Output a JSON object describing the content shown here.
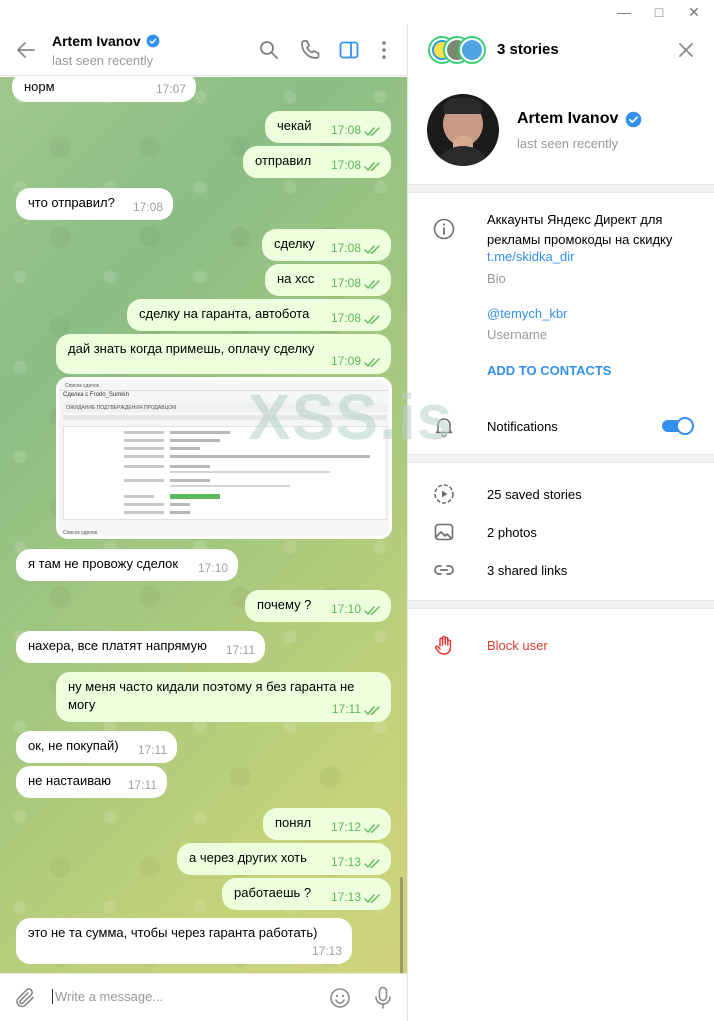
{
  "chat": {
    "name": "Artem Ivanov",
    "status": "last seen recently",
    "input_placeholder": "Write a message..."
  },
  "messages": [
    {
      "dir": "in",
      "text": "норм",
      "time": "17:07"
    },
    {
      "dir": "out",
      "text": "чекай",
      "time": "17:08"
    },
    {
      "dir": "out",
      "text": "отправил",
      "time": "17:08"
    },
    {
      "dir": "in",
      "text": "что отправил?",
      "time": "17:08"
    },
    {
      "dir": "out",
      "text": "сделку",
      "time": "17:08"
    },
    {
      "dir": "out",
      "text": "на хсс",
      "time": "17:08"
    },
    {
      "dir": "out",
      "text": "сделку на гаранта, автобота",
      "time": "17:08"
    },
    {
      "dir": "out",
      "text": "дай знать когда примешь, оплачу сделку",
      "time": "17:09"
    },
    {
      "dir": "in",
      "text": "я там не провожу сделок",
      "time": "17:10"
    },
    {
      "dir": "out",
      "text": "почему ?",
      "time": "17:10"
    },
    {
      "dir": "in",
      "text": "нахера, все платят напрямую",
      "time": "17:11"
    },
    {
      "dir": "out",
      "text": "ну меня часто кидали поэтому я без гаранта не могу",
      "time": "17:11"
    },
    {
      "dir": "in",
      "text": "ок, не покупай)",
      "time": "17:11"
    },
    {
      "dir": "in",
      "text": "не настаиваю",
      "time": "17:11"
    },
    {
      "dir": "out",
      "text": "понял",
      "time": "17:12"
    },
    {
      "dir": "out",
      "text": "а через других хоть",
      "time": "17:13"
    },
    {
      "dir": "out",
      "text": "работаешь ?",
      "time": "17:13"
    },
    {
      "dir": "in",
      "text": "это не та сумма, чтобы через гаранта работать)",
      "time": "17:13"
    }
  ],
  "screenshot": {
    "breadcrumb": "Список сделок",
    "title": "Сделка с Frodo_Sumkin",
    "banner": "ОЖИДАНИЕ ПОДТВЕРЖДЕНИЯ ПРОДАВЦОМ",
    "footer": "Список сделок"
  },
  "watermark": "XSS.is",
  "profile": {
    "stories_label": "3 stories",
    "name": "Artem Ivanov",
    "status": "last seen recently",
    "bio": "Аккаунты Яндекс Директ для рекламы промокоды на скидку",
    "bio_link": "t.me/skidka_dir",
    "bio_caption": "Bio",
    "username": "@temych_kbr",
    "username_caption": "Username",
    "add_contacts": "ADD TO CONTACTS",
    "notifications": "Notifications",
    "notifications_on": true,
    "saved_stories": "25 saved stories",
    "photos": "2 photos",
    "shared_links": "3 shared links",
    "block_user": "Block user"
  },
  "colors": {
    "accent": "#3390ec",
    "verified": "#3390ec",
    "out_time": "#5fb75a",
    "block": "#e53935"
  }
}
